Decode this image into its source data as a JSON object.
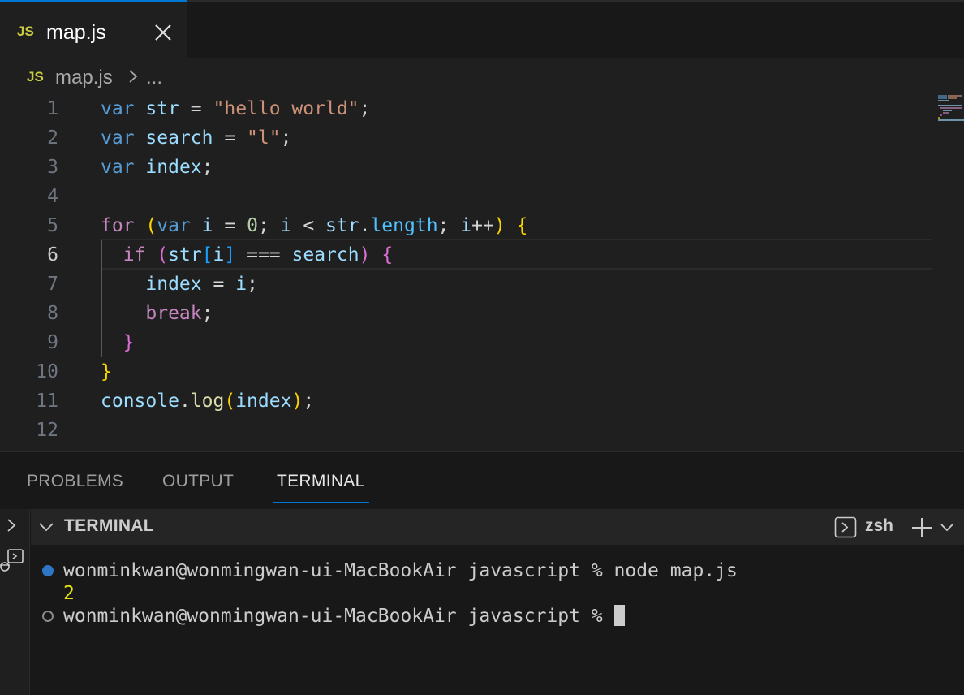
{
  "tab": {
    "lang_badge": "JS",
    "filename": "map.js"
  },
  "breadcrumb": {
    "lang_badge": "JS",
    "file": "map.js",
    "more": "..."
  },
  "editor": {
    "active_line": 6,
    "lines": [
      {
        "n": "1",
        "tokens": [
          [
            "kw",
            "var"
          ],
          [
            "pl",
            " "
          ],
          [
            "var",
            "str"
          ],
          [
            "pl",
            " = "
          ],
          [
            "str",
            "\"hello world\""
          ],
          [
            "pl",
            ";"
          ]
        ]
      },
      {
        "n": "2",
        "tokens": [
          [
            "kw",
            "var"
          ],
          [
            "pl",
            " "
          ],
          [
            "var",
            "search"
          ],
          [
            "pl",
            " = "
          ],
          [
            "str",
            "\"l\""
          ],
          [
            "pl",
            ";"
          ]
        ]
      },
      {
        "n": "3",
        "tokens": [
          [
            "kw",
            "var"
          ],
          [
            "pl",
            " "
          ],
          [
            "var",
            "index"
          ],
          [
            "pl",
            ";"
          ]
        ]
      },
      {
        "n": "4",
        "tokens": []
      },
      {
        "n": "5",
        "tokens": [
          [
            "ctl",
            "for"
          ],
          [
            "pl",
            " "
          ],
          [
            "br1",
            "("
          ],
          [
            "kw",
            "var"
          ],
          [
            "pl",
            " "
          ],
          [
            "var",
            "i"
          ],
          [
            "pl",
            " = "
          ],
          [
            "num",
            "0"
          ],
          [
            "pl",
            "; "
          ],
          [
            "var",
            "i"
          ],
          [
            "pl",
            " < "
          ],
          [
            "var",
            "str"
          ],
          [
            "pl",
            "."
          ],
          [
            "prop",
            "length"
          ],
          [
            "pl",
            "; "
          ],
          [
            "var",
            "i"
          ],
          [
            "pl",
            "++"
          ],
          [
            "br1",
            ")"
          ],
          [
            "pl",
            " "
          ],
          [
            "br1",
            "{"
          ]
        ]
      },
      {
        "n": "6",
        "tokens": [
          [
            "pl",
            "  "
          ],
          [
            "ctl",
            "if"
          ],
          [
            "pl",
            " "
          ],
          [
            "br2",
            "("
          ],
          [
            "var",
            "str"
          ],
          [
            "br3",
            "["
          ],
          [
            "var",
            "i"
          ],
          [
            "br3",
            "]"
          ],
          [
            "pl",
            " === "
          ],
          [
            "var",
            "search"
          ],
          [
            "br2",
            ")"
          ],
          [
            "pl",
            " "
          ],
          [
            "br2",
            "{"
          ]
        ]
      },
      {
        "n": "7",
        "tokens": [
          [
            "pl",
            "    "
          ],
          [
            "var",
            "index"
          ],
          [
            "pl",
            " = "
          ],
          [
            "var",
            "i"
          ],
          [
            "pl",
            ";"
          ]
        ]
      },
      {
        "n": "8",
        "tokens": [
          [
            "pl",
            "    "
          ],
          [
            "ctl",
            "break"
          ],
          [
            "pl",
            ";"
          ]
        ]
      },
      {
        "n": "9",
        "tokens": [
          [
            "pl",
            "  "
          ],
          [
            "br2",
            "}"
          ]
        ]
      },
      {
        "n": "10",
        "tokens": [
          [
            "br1",
            "}"
          ]
        ]
      },
      {
        "n": "11",
        "tokens": [
          [
            "var",
            "console"
          ],
          [
            "pl",
            "."
          ],
          [
            "fn",
            "log"
          ],
          [
            "br1",
            "("
          ],
          [
            "var",
            "index"
          ],
          [
            "br1",
            ")"
          ],
          [
            "pl",
            ";"
          ]
        ]
      },
      {
        "n": "12",
        "tokens": []
      }
    ]
  },
  "panel": {
    "tabs": [
      "PROBLEMS",
      "OUTPUT",
      "TERMINAL"
    ],
    "active_tab": "TERMINAL",
    "section_title": "TERMINAL",
    "shell_name": "zsh"
  },
  "terminal": {
    "prompt1": "wonminkwan@wonmingwan-ui-MacBookAir javascript % node map.js",
    "output": "2",
    "prompt2": "wonminkwan@wonmingwan-ui-MacBookAir javascript % "
  },
  "colors": {
    "accent": "#0078d4",
    "js_badge": "#cbcb41",
    "terminal_output": "#e5e510",
    "dot_success": "#3794ff"
  },
  "icons": [
    "close-icon",
    "chevron-right-icon",
    "chevron-down-icon",
    "terminal-icon",
    "plus-icon",
    "debug-console-icon"
  ]
}
